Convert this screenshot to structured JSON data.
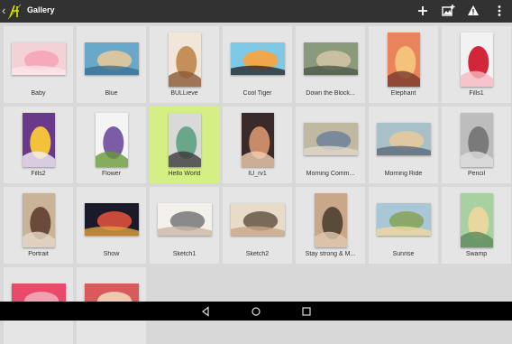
{
  "app": {
    "title": "Gallery"
  },
  "toolbar": {
    "actions": [
      "add-icon",
      "add-photo-icon",
      "warning-icon",
      "overflow-menu-icon"
    ]
  },
  "gallery": {
    "items": [
      {
        "label": "Baby",
        "colors": [
          "#f3d2d6",
          "#f6a9b8",
          "#fbe6ea"
        ]
      },
      {
        "label": "Blue",
        "colors": [
          "#6aa8c9",
          "#d9c5a0",
          "#3b6f95"
        ]
      },
      {
        "label": "BULLieve",
        "colors": [
          "#f1e7d8",
          "#c58f5a",
          "#8a5a36"
        ]
      },
      {
        "label": "Cool Tiger",
        "colors": [
          "#7fc8e6",
          "#f0a64a",
          "#2a2a2a"
        ]
      },
      {
        "label": "Down the Block...",
        "colors": [
          "#8a9a7c",
          "#c8c0a0",
          "#4d5a4a"
        ]
      },
      {
        "label": "Elephant",
        "colors": [
          "#e9845c",
          "#f4c27a",
          "#7a3b2e"
        ]
      },
      {
        "label": "Fills1",
        "colors": [
          "#f2f2f2",
          "#d2263a",
          "#f7b8c0"
        ]
      },
      {
        "label": "Fills2",
        "colors": [
          "#6a3a8a",
          "#f2c23a",
          "#f5f0f5"
        ]
      },
      {
        "label": "Flower",
        "colors": [
          "#f4f4f4",
          "#7b5da6",
          "#6a9a3a"
        ]
      },
      {
        "label": "Hello World",
        "colors": [
          "#d9d9d9",
          "#6aa78a",
          "#3b3b3b"
        ]
      },
      {
        "label": "IU_rv1",
        "colors": [
          "#3a2a2a",
          "#c98a6a",
          "#f0d0b0"
        ]
      },
      {
        "label": "Morning Comm...",
        "colors": [
          "#c0b8a0",
          "#7a8a9a",
          "#e0d8c8"
        ]
      },
      {
        "label": "Morning Ride",
        "colors": [
          "#a8c0c8",
          "#e0c8a0",
          "#5a6a7a"
        ]
      },
      {
        "label": "Pencil",
        "colors": [
          "#bdbdbd",
          "#7a7a7a",
          "#e0e0e0"
        ]
      },
      {
        "label": "Portrait",
        "colors": [
          "#c9b49a",
          "#6a4a3a",
          "#e6d8c8"
        ]
      },
      {
        "label": "Show",
        "colors": [
          "#1a1a2a",
          "#c84a3a",
          "#e0a040"
        ]
      },
      {
        "label": "Sketch1",
        "colors": [
          "#f4f0ec",
          "#8a8a8a",
          "#c9b8a8"
        ]
      },
      {
        "label": "Sketch2",
        "colors": [
          "#e8dcc8",
          "#7a6a5a",
          "#c8a888"
        ]
      },
      {
        "label": "Stay strong & M...",
        "colors": [
          "#c8a888",
          "#5a4a3a",
          "#e0c8b0"
        ]
      },
      {
        "label": "Sunrise",
        "colors": [
          "#a8c8d8",
          "#8aa86a",
          "#f0d8a0"
        ]
      },
      {
        "label": "Swamp",
        "colors": [
          "#a8d0a0",
          "#e8d8a0",
          "#5a8a5a"
        ]
      },
      {
        "label": "",
        "colors": [
          "#e84a6a",
          "#f0a0b0",
          "#a83a5a"
        ]
      },
      {
        "label": "",
        "colors": [
          "#d85a5a",
          "#f0c8b0",
          "#a05040"
        ]
      }
    ]
  },
  "system_nav": {
    "buttons": [
      "back-icon",
      "home-icon",
      "recents-icon"
    ]
  },
  "colors": {
    "appbar": "#323232",
    "background": "#d8d8d8",
    "tile": "#e5e5e5",
    "selected_tile": "#d6ef85",
    "navbar": "#000000"
  }
}
